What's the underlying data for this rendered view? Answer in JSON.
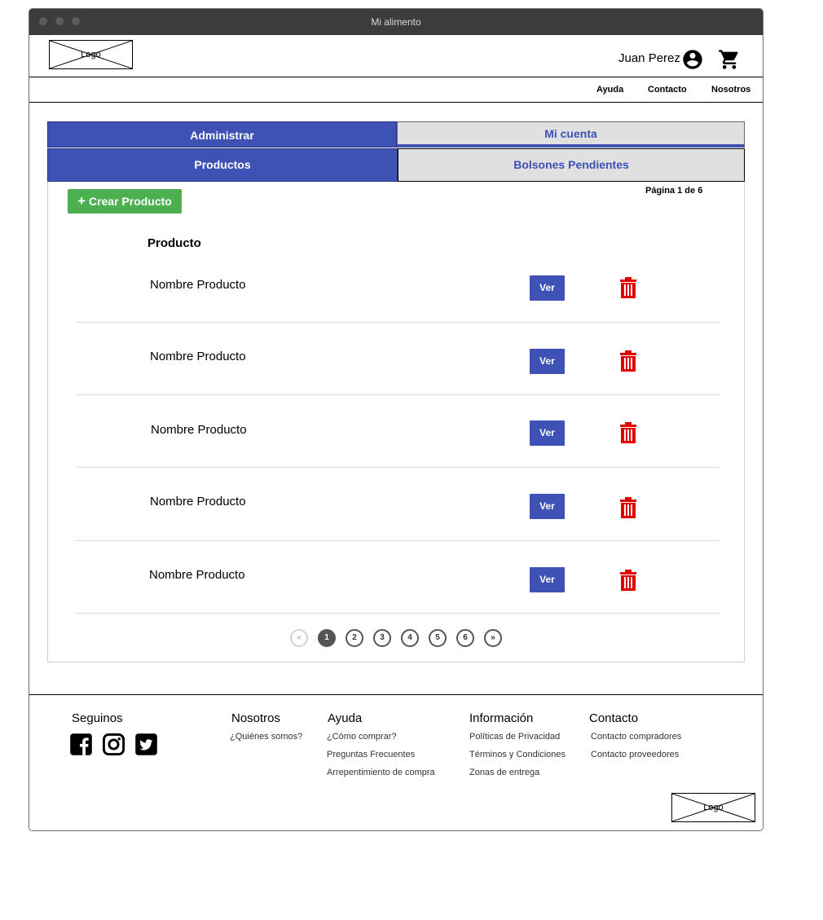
{
  "window": {
    "title": "Mi alimento"
  },
  "header": {
    "logo_text": "Logo",
    "user_name": "Juan Perez",
    "user_icon": "account-circle-icon",
    "cart_icon": "shopping-cart-icon"
  },
  "nav": {
    "items": [
      "Ayuda",
      "Contacto",
      "Nosotros"
    ]
  },
  "tabs": {
    "top": [
      "Administrar",
      "Mi cuenta"
    ],
    "sub": [
      "Productos",
      "Bolsones Pendientes"
    ]
  },
  "content": {
    "create_button": "Crear Producto",
    "page_info": "Página 1 de 6",
    "column_header": "Producto",
    "rows": [
      {
        "name": "Nombre Producto",
        "view_label": "Ver"
      },
      {
        "name": "Nombre Producto",
        "view_label": "Ver"
      },
      {
        "name": "Nombre Producto",
        "view_label": "Ver"
      },
      {
        "name": "Nombre Producto",
        "view_label": "Ver"
      },
      {
        "name": "Nombre Producto",
        "view_label": "Ver"
      }
    ],
    "pagination": {
      "first": "«",
      "pages": [
        "1",
        "2",
        "3",
        "4",
        "5",
        "6"
      ],
      "last": "»",
      "current": "1"
    }
  },
  "footer": {
    "follow": {
      "title": "Seguinos",
      "icons": [
        "facebook-icon",
        "instagram-icon",
        "twitter-icon"
      ]
    },
    "columns": [
      {
        "title": "Nosotros",
        "links": [
          "¿Quiénes somos?"
        ]
      },
      {
        "title": "Ayuda",
        "links": [
          "¿Cómo comprar?",
          "Preguntas Frecuentes",
          "Arrepentimiento de compra"
        ]
      },
      {
        "title": "Información",
        "links": [
          "Políticas de Privacidad",
          "Términos y Condiciones",
          "Zonas de entrega"
        ]
      },
      {
        "title": "Contacto",
        "links": [
          "Contacto compradores",
          "Contacto proveedores"
        ]
      }
    ],
    "logo_text": "Logo"
  },
  "colors": {
    "primary": "#3e51b5",
    "success": "#4caf50",
    "danger": "#e00000",
    "tab_inactive": "#e0e0e0"
  }
}
